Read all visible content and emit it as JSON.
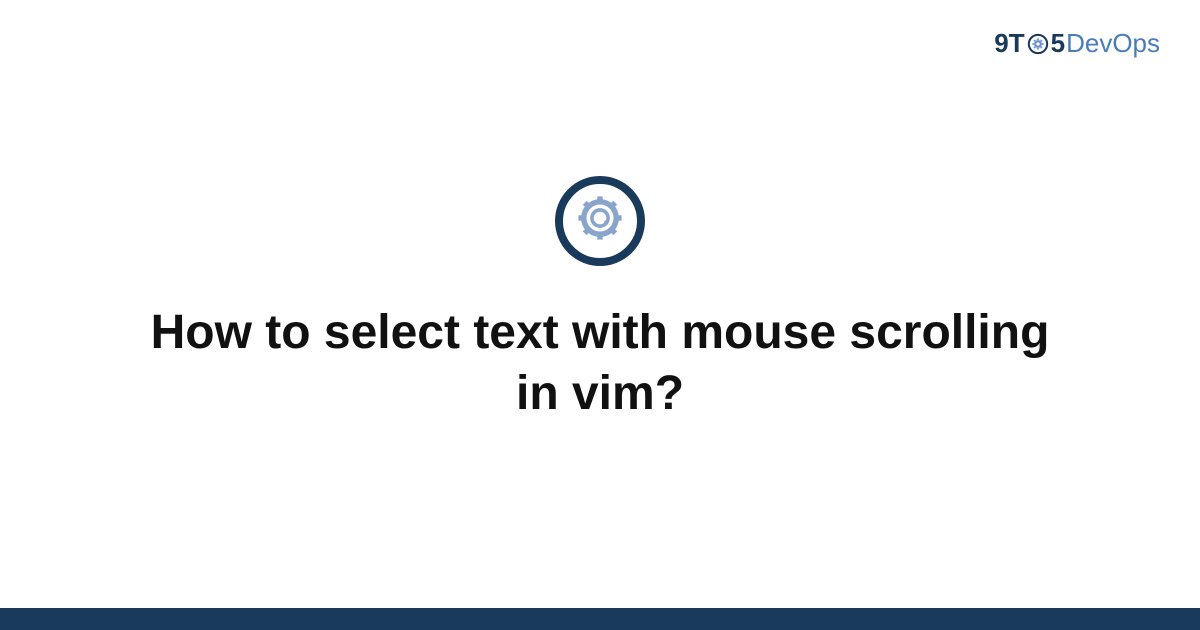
{
  "logo": {
    "part1": "9T",
    "part2": "5",
    "part3": "DevOps"
  },
  "title": "How to select text with mouse scrolling in vim?",
  "colors": {
    "dark_blue": "#1a3a5c",
    "light_blue": "#6a8fc4"
  }
}
